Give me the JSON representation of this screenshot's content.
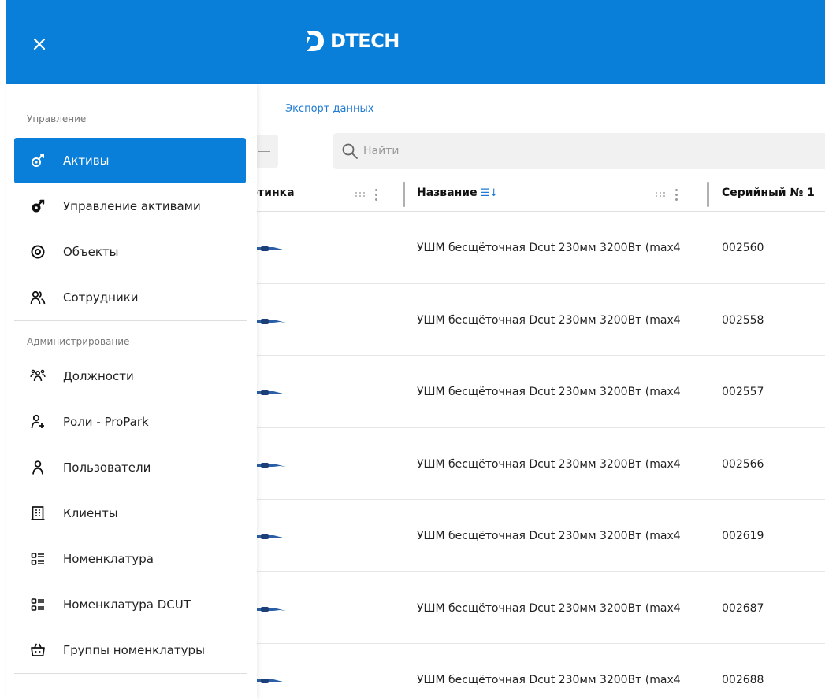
{
  "header": {
    "brand": "DTECH",
    "color": "#0a7fd9"
  },
  "main": {
    "export_label": "Экспорт данных",
    "search_placeholder": "Найти",
    "columns": {
      "image_partial": "ртинка",
      "name": "Название",
      "serial_partial": "Серийный № 1"
    },
    "rows": [
      {
        "name": "УШМ бесщёточная Dcut 230мм 3200Вт (max4",
        "serial": "002560"
      },
      {
        "name": "УШМ бесщёточная Dcut 230мм 3200Вт (max4",
        "serial": "002558"
      },
      {
        "name": "УШМ бесщёточная Dcut 230мм 3200Вт (max4",
        "serial": "002557"
      },
      {
        "name": "УШМ бесщёточная Dcut 230мм 3200Вт (max4",
        "serial": "002566"
      },
      {
        "name": "УШМ бесщёточная Dcut 230мм 3200Вт (max4",
        "serial": "002619"
      },
      {
        "name": "УШМ бесщёточная Dcut 230мм 3200Вт (max4",
        "serial": "002687"
      },
      {
        "name": "УШМ бесщёточная Dcut 230мм 3200Вт (max4",
        "serial": "002688"
      }
    ]
  },
  "drawer": {
    "section_management": "Управление",
    "section_admin": "Администрирование",
    "items": [
      {
        "label": "Активы",
        "icon": "assets-icon",
        "active": true
      },
      {
        "label": "Управление активами",
        "icon": "asset-management-icon"
      },
      {
        "label": "Объекты",
        "icon": "location-icon"
      },
      {
        "label": "Сотрудники",
        "icon": "employees-icon"
      },
      {
        "label": "Должности",
        "icon": "positions-icon"
      },
      {
        "label": "Роли - ProPark",
        "icon": "roles-icon"
      },
      {
        "label": "Пользователи",
        "icon": "user-icon"
      },
      {
        "label": "Клиенты",
        "icon": "building-icon"
      },
      {
        "label": "Номенклатура",
        "icon": "list-icon"
      },
      {
        "label": "Номенклатура DCUT",
        "icon": "list-icon"
      },
      {
        "label": "Группы номенклатуры",
        "icon": "basket-icon"
      }
    ]
  }
}
